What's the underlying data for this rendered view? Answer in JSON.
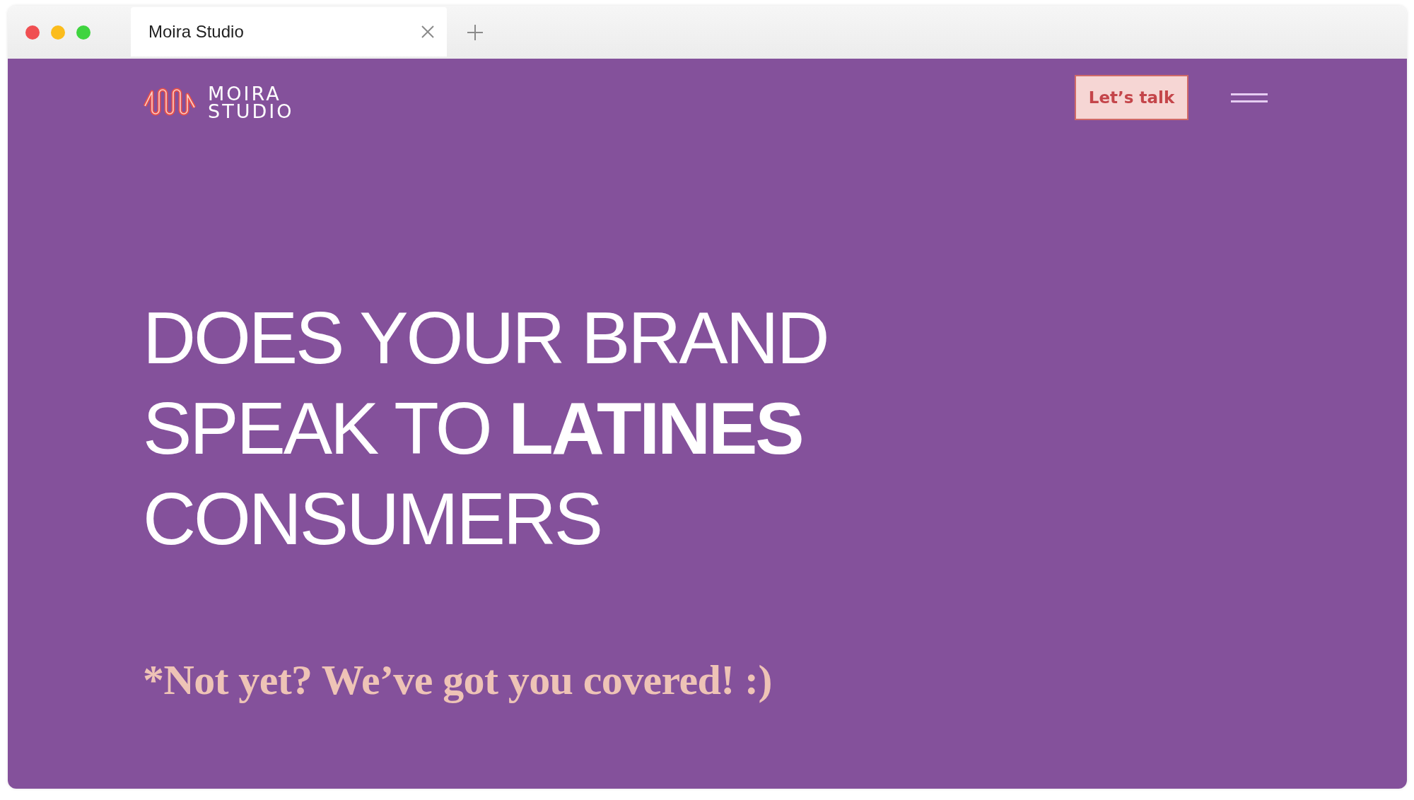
{
  "browser": {
    "tabs": [
      {
        "title": "Moira Studio",
        "selected": true
      }
    ]
  },
  "header": {
    "logo_lines": [
      "MOIRA",
      "STUDIO"
    ],
    "cta": "Let’s talk"
  },
  "hero": {
    "headline_lines": [
      "DOES YOUR BRAND",
      "SPEAK TO **LATINES**",
      "CONSUMERS"
    ],
    "tagline": "*Not yet? We’ve got you covered! :)"
  }
}
